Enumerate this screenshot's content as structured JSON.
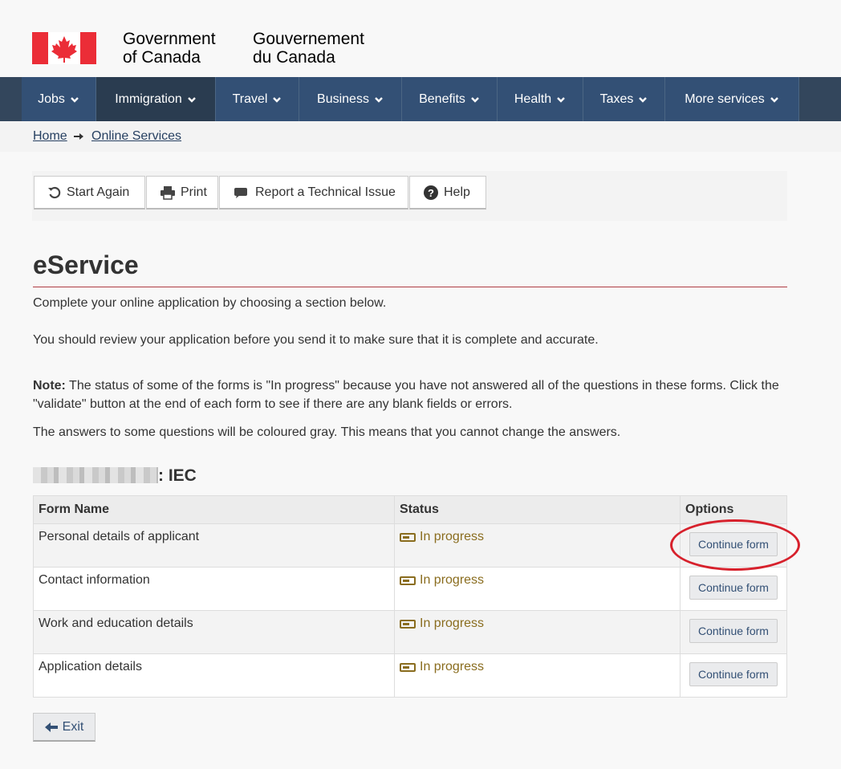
{
  "header": {
    "signature_en_line1": "Government",
    "signature_en_line2": "of Canada",
    "signature_fr_line1": "Gouvernement",
    "signature_fr_line2": "du Canada",
    "flag_color": "#eb2d37"
  },
  "menu": {
    "items": [
      {
        "label": "Jobs"
      },
      {
        "label": "Immigration"
      },
      {
        "label": "Travel"
      },
      {
        "label": "Business"
      },
      {
        "label": "Benefits"
      },
      {
        "label": "Health"
      },
      {
        "label": "Taxes"
      },
      {
        "label": "More services"
      }
    ],
    "active_item": "Immigration"
  },
  "breadcrumb": {
    "home": "Home",
    "current": "Online Services"
  },
  "toolbar": {
    "start_again": "Start Again",
    "print": "Print",
    "report": "Report a Technical Issue",
    "help": "Help"
  },
  "page": {
    "title": "eService",
    "intro": "Complete your online application by choosing a section below.",
    "review": "You should review your application before you send it to make sure that it is complete and accurate.",
    "note_label": "Note:",
    "note_text": " The status of some of the forms is \"In progress\" because you have not answered all of the questions in these forms. Click the \"validate\" button at the end of each form to see if there are any blank fields or errors.",
    "gray_note": "The answers to some questions will be coloured gray. This means that you cannot change the answers.",
    "section_suffix": ": IEC"
  },
  "table": {
    "headers": {
      "form_name": "Form Name",
      "status": "Status",
      "options": "Options"
    },
    "rows": [
      {
        "name": "Personal details of applicant",
        "status": "In progress",
        "action": "Continue form"
      },
      {
        "name": "Contact information",
        "status": "In progress",
        "action": "Continue form"
      },
      {
        "name": "Work and education details",
        "status": "In progress",
        "action": "Continue form"
      },
      {
        "name": "Application details",
        "status": "In progress",
        "action": "Continue form"
      }
    ]
  },
  "exit_label": "Exit",
  "colors": {
    "nav": "#335075",
    "status": "#8a6d1f",
    "rule": "#af3c43",
    "annotation": "#d7212c"
  },
  "icons": [
    "canada-flag-icon",
    "chevron-down-icon",
    "arrow-right-icon",
    "restart-icon",
    "printer-icon",
    "comment-icon",
    "question-icon",
    "status-progress-icon",
    "arrow-left-icon"
  ]
}
